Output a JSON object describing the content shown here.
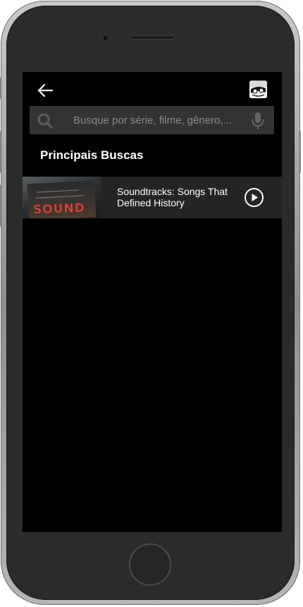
{
  "header": {
    "back_icon": "arrow-left-icon",
    "avatar_icon": "profile-avatar"
  },
  "search": {
    "placeholder": "Busque por série, filme, gênero,...",
    "value": "",
    "icon": "search-icon",
    "mic_icon": "microphone-icon"
  },
  "section": {
    "title": "Principais Buscas"
  },
  "results": [
    {
      "title": "Soundtracks: Songs That Defined History",
      "thumbnail_text": "SOUND",
      "action_icon": "play-circle-icon"
    }
  ],
  "colors": {
    "background": "#000000",
    "search_bg": "#333333",
    "row_bg": "#242424",
    "text": "#ffffff",
    "placeholder": "#8a8a8a",
    "icon_gray": "#555555"
  }
}
